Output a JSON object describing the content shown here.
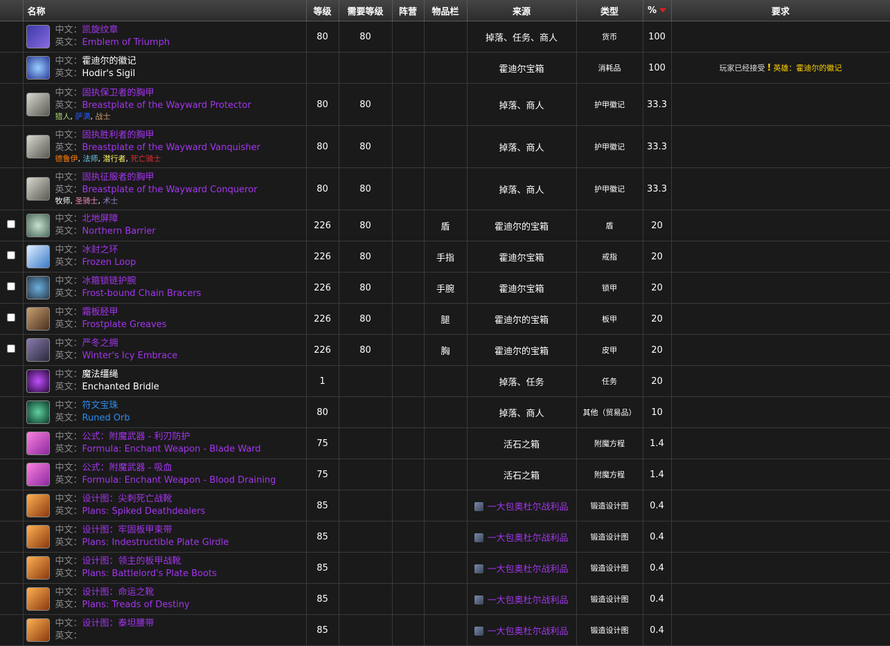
{
  "headers": {
    "name": "名称",
    "level": "等级",
    "req_level": "需要等级",
    "side": "阵营",
    "slot": "物品栏",
    "source": "来源",
    "type": "类型",
    "pct": "%",
    "reqs": "要求"
  },
  "labels": {
    "cn": "中文：",
    "en": "英文："
  },
  "rows": [
    {
      "cn": "凯旋纹章",
      "en": "Emblem of Triumph",
      "q": "epic",
      "level": "80",
      "req": "80",
      "slot": "",
      "source": "掉落、任务、商人",
      "type": "货币",
      "pct": "100",
      "check": false,
      "icon": "emblem-icon",
      "bg": "linear-gradient(135deg,#3a3aa8,#8a6ae0)"
    },
    {
      "cn": "霍迪尔的徽记",
      "en": "Hodir's Sigil",
      "q": "common",
      "level": "",
      "req": "",
      "slot": "",
      "source": "霍迪尔宝箱",
      "type": "消耗品",
      "pct": "100",
      "check": false,
      "icon": "sigil-icon",
      "bg": "radial-gradient(circle,#9ad0ff,#2a3a9a)",
      "reqs_text": "玩家已经接受",
      "reqs_quest": "英雄：霍迪尔的徽记"
    },
    {
      "cn": "固执保卫者的胸甲",
      "en": "Breastplate of the Wayward Protector",
      "q": "epic",
      "level": "80",
      "req": "80",
      "slot": "",
      "source": "掉落、商人",
      "type": "护甲徽记",
      "pct": "33.3",
      "check": false,
      "icon": "breastplate-icon",
      "bg": "linear-gradient(135deg,#d8d8d0,#5a5a52)",
      "classes": [
        {
          "n": "猎人",
          "c": "#abd473"
        },
        {
          "n": "萨满",
          "c": "#2459ff"
        },
        {
          "n": "战士",
          "c": "#c79c6e"
        }
      ]
    },
    {
      "cn": "固执胜利者的胸甲",
      "en": "Breastplate of the Wayward Vanquisher",
      "q": "epic",
      "level": "80",
      "req": "80",
      "slot": "",
      "source": "掉落、商人",
      "type": "护甲徽记",
      "pct": "33.3",
      "check": false,
      "icon": "breastplate-icon",
      "bg": "linear-gradient(135deg,#d8d8d0,#5a5a52)",
      "classes": [
        {
          "n": "德鲁伊",
          "c": "#ff7d0a"
        },
        {
          "n": "法师",
          "c": "#69ccf0"
        },
        {
          "n": "潜行者",
          "c": "#fff569"
        },
        {
          "n": "死亡骑士",
          "c": "#e03030"
        }
      ]
    },
    {
      "cn": "固执征服者的胸甲",
      "en": "Breastplate of the Wayward Conqueror",
      "q": "epic",
      "level": "80",
      "req": "80",
      "slot": "",
      "source": "掉落、商人",
      "type": "护甲徽记",
      "pct": "33.3",
      "check": false,
      "icon": "breastplate-icon",
      "bg": "linear-gradient(135deg,#d8d8d0,#5a5a52)",
      "classes": [
        {
          "n": "牧师",
          "c": "#ffffff"
        },
        {
          "n": "圣骑士",
          "c": "#f58cba"
        },
        {
          "n": "术士",
          "c": "#9482c9"
        }
      ]
    },
    {
      "cn": "北地屏障",
      "en": "Northern Barrier",
      "q": "epic",
      "level": "226",
      "req": "80",
      "slot": "盾",
      "source": "霍迪尔的宝箱",
      "type": "盾",
      "pct": "20",
      "check": true,
      "icon": "shield-icon",
      "bg": "radial-gradient(circle,#c8e0d0,#4a6a5a)"
    },
    {
      "cn": "冰封之环",
      "en": "Frozen Loop",
      "q": "epic",
      "level": "226",
      "req": "80",
      "slot": "手指",
      "source": "霍迪尔宝箱",
      "type": "戒指",
      "pct": "20",
      "check": true,
      "icon": "ring-icon",
      "bg": "linear-gradient(135deg,#e0f0ff,#3a7ac8)"
    },
    {
      "cn": "冰箍锁链护腕",
      "en": "Frost-bound Chain Bracers",
      "q": "epic",
      "level": "226",
      "req": "80",
      "slot": "手腕",
      "source": "霍迪尔宝箱",
      "type": "锁甲",
      "pct": "20",
      "check": true,
      "icon": "bracers-icon",
      "bg": "radial-gradient(circle,#6ab0e0,#2a3a4a)"
    },
    {
      "cn": "霜板胫甲",
      "en": "Frostplate Greaves",
      "q": "epic",
      "level": "226",
      "req": "80",
      "slot": "腿",
      "source": "霍迪尔的宝箱",
      "type": "板甲",
      "pct": "20",
      "check": true,
      "icon": "greaves-icon",
      "bg": "linear-gradient(135deg,#c8a070,#4a3020)"
    },
    {
      "cn": "严冬之拥",
      "en": "Winter's Icy Embrace",
      "q": "epic",
      "level": "226",
      "req": "80",
      "slot": "胸",
      "source": "霍迪尔的宝箱",
      "type": "皮甲",
      "pct": "20",
      "check": true,
      "icon": "chest-icon",
      "bg": "linear-gradient(135deg,#8a7ab0,#2a2a3a)"
    },
    {
      "cn": "魔法缰绳",
      "en": "Enchanted Bridle",
      "q": "common",
      "level": "1",
      "req": "",
      "slot": "",
      "source": "掉落、任务",
      "type": "任务",
      "pct": "20",
      "check": false,
      "icon": "bridle-icon",
      "bg": "radial-gradient(circle,#c050ff,#2a0a3a)"
    },
    {
      "cn": "符文宝珠",
      "en": "Runed Orb",
      "q": "rare",
      "level": "80",
      "req": "",
      "slot": "",
      "source": "掉落、商人",
      "type": "其他（贸易品）",
      "pct": "10",
      "check": false,
      "icon": "orb-icon",
      "bg": "radial-gradient(circle,#60d0a0,#0a3a2a)"
    },
    {
      "cn": "公式：附魔武器 - 利刃防护",
      "en": "Formula: Enchant Weapon - Blade Ward",
      "q": "epic",
      "level": "75",
      "req": "",
      "slot": "",
      "source": "活石之箱",
      "type": "附魔方程",
      "pct": "1.4",
      "check": false,
      "icon": "formula-icon",
      "bg": "linear-gradient(135deg,#ff80e0,#8a2aa0)"
    },
    {
      "cn": "公式：附魔武器 - 吸血",
      "en": "Formula: Enchant Weapon - Blood Draining",
      "q": "epic",
      "level": "75",
      "req": "",
      "slot": "",
      "source": "活石之箱",
      "type": "附魔方程",
      "pct": "1.4",
      "check": false,
      "icon": "formula-icon",
      "bg": "linear-gradient(135deg,#ff80e0,#8a2aa0)"
    },
    {
      "cn": "设计图：尖刺死亡战靴",
      "en": "Plans: Spiked Deathdealers",
      "q": "epic",
      "level": "85",
      "req": "",
      "slot": "",
      "source": "一大包奥杜尔战利品",
      "source_link": true,
      "type": "锻造设计图",
      "pct": "0.4",
      "check": false,
      "icon": "plans-icon",
      "bg": "linear-gradient(135deg,#ffb050,#8a3a10)"
    },
    {
      "cn": "设计图：牢固板甲束带",
      "en": "Plans: Indestructible Plate Girdle",
      "q": "epic",
      "level": "85",
      "req": "",
      "slot": "",
      "source": "一大包奥杜尔战利品",
      "source_link": true,
      "type": "锻造设计图",
      "pct": "0.4",
      "check": false,
      "icon": "plans-icon",
      "bg": "linear-gradient(135deg,#ffb050,#8a3a10)"
    },
    {
      "cn": "设计图：领主的板甲战靴",
      "en": "Plans: Battlelord's Plate Boots",
      "q": "epic",
      "level": "85",
      "req": "",
      "slot": "",
      "source": "一大包奥杜尔战利品",
      "source_link": true,
      "type": "锻造设计图",
      "pct": "0.4",
      "check": false,
      "icon": "plans-icon",
      "bg": "linear-gradient(135deg,#ffb050,#8a3a10)"
    },
    {
      "cn": "设计图：命运之靴",
      "en": "Plans: Treads of Destiny",
      "q": "epic",
      "level": "85",
      "req": "",
      "slot": "",
      "source": "一大包奥杜尔战利品",
      "source_link": true,
      "type": "锻造设计图",
      "pct": "0.4",
      "check": false,
      "icon": "plans-icon",
      "bg": "linear-gradient(135deg,#ffb050,#8a3a10)"
    },
    {
      "cn": "设计图：泰坦腰带",
      "en": "",
      "q": "epic",
      "level": "85",
      "req": "",
      "slot": "",
      "source": "一大包奥杜尔战利品",
      "source_link": true,
      "type": "锻造设计图",
      "pct": "0.4",
      "check": false,
      "icon": "plans-icon",
      "bg": "linear-gradient(135deg,#ffb050,#8a3a10)"
    }
  ]
}
